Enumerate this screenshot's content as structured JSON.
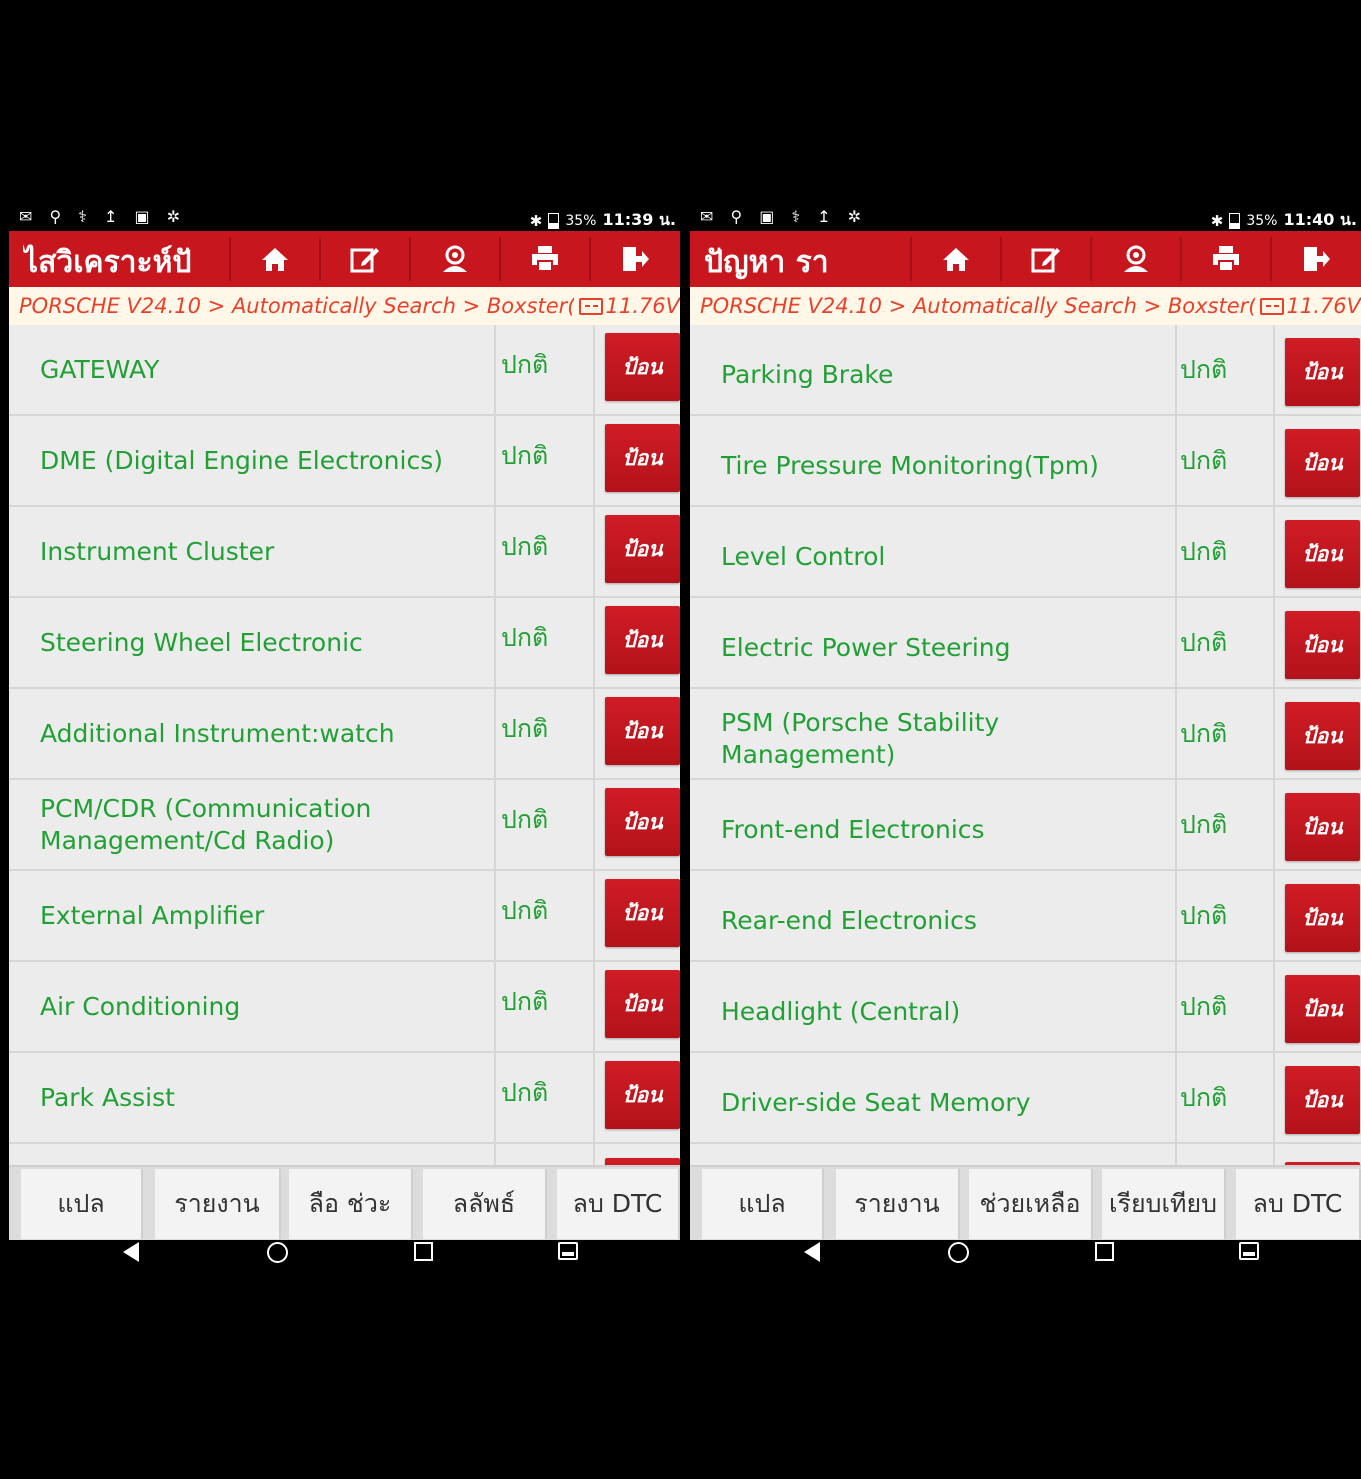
{
  "panels": [
    {
      "status_bar": {
        "left_icons": "✉ ⚲ ⚕ ↥ ▣ ✲",
        "bluetooth": "✱",
        "battery": "35%",
        "time": "11:39 น."
      },
      "toolbar": {
        "title": "ไสวิเคราะห์ปั",
        "icons": [
          "home-icon",
          "edit-icon",
          "user-icon",
          "print-icon",
          "exit-icon"
        ]
      },
      "breadcrumb": {
        "path": "PORSCHE V24.10 > Automatically Search > Boxster(...",
        "voltage": "11.76V"
      },
      "rows": [
        {
          "name": "GATEWAY",
          "status": "ปกติ",
          "button": "ป้อน"
        },
        {
          "name": "DME (Digital Engine Electronics)",
          "status": "ปกติ",
          "button": "ป้อน"
        },
        {
          "name": "Instrument Cluster",
          "status": "ปกติ",
          "button": "ป้อน"
        },
        {
          "name": "Steering Wheel Electronic",
          "status": "ปกติ",
          "button": "ป้อน"
        },
        {
          "name": "Additional Instrument:watch",
          "status": "ปกติ",
          "button": "ป้อน"
        },
        {
          "name": "PCM/CDR (Communication Management/Cd Radio)",
          "status": "ปกติ",
          "button": "ป้อน"
        },
        {
          "name": "External Amplifier",
          "status": "ปกติ",
          "button": "ป้อน"
        },
        {
          "name": "Air Conditioning",
          "status": "ปกติ",
          "button": "ป้อน"
        },
        {
          "name": "Park Assist",
          "status": "ปกติ",
          "button": "ป้อน"
        }
      ],
      "bottom_buttons": [
        "แปล",
        "รายงาน",
        "ลือ     ช่วะ",
        "ลลัพธ์",
        "ลบ DTC"
      ]
    },
    {
      "status_bar": {
        "left_icons": "✉ ⚲ ▣ ⚕ ↥ ✲",
        "bluetooth": "✱",
        "battery": "35%",
        "time": "11:40 น."
      },
      "toolbar": {
        "title": "ปัญหา      รา",
        "icons": [
          "home-icon",
          "edit-icon",
          "user-icon",
          "print-icon",
          "exit-icon"
        ]
      },
      "breadcrumb": {
        "path": "PORSCHE V24.10 > Automatically Search > Boxster(...",
        "voltage": "11.76V"
      },
      "rows": [
        {
          "name": "Parking Brake",
          "status": "ปกติ",
          "button": "ป้อน"
        },
        {
          "name": "Tire Pressure Monitoring(Tpm)",
          "status": "ปกติ",
          "button": "ป้อน"
        },
        {
          "name": "Level Control",
          "status": "ปกติ",
          "button": "ป้อน"
        },
        {
          "name": "Electric Power Steering",
          "status": "ปกติ",
          "button": "ป้อน"
        },
        {
          "name": "PSM (Porsche Stability Management)",
          "status": "ปกติ",
          "button": "ป้อน"
        },
        {
          "name": "Front-end Electronics",
          "status": "ปกติ",
          "button": "ป้อน"
        },
        {
          "name": "Rear-end Electronics",
          "status": "ปกติ",
          "button": "ป้อน"
        },
        {
          "name": "Headlight (Central)",
          "status": "ปกติ",
          "button": "ป้อน"
        },
        {
          "name": "Driver-side Seat Memory",
          "status": "ปกติ",
          "button": "ป้อน"
        }
      ],
      "bottom_buttons": [
        "แปล",
        "รายงาน",
        "ช่วยเหลือ",
        "เรียบเทียบ",
        "ลบ DTC"
      ]
    }
  ]
}
